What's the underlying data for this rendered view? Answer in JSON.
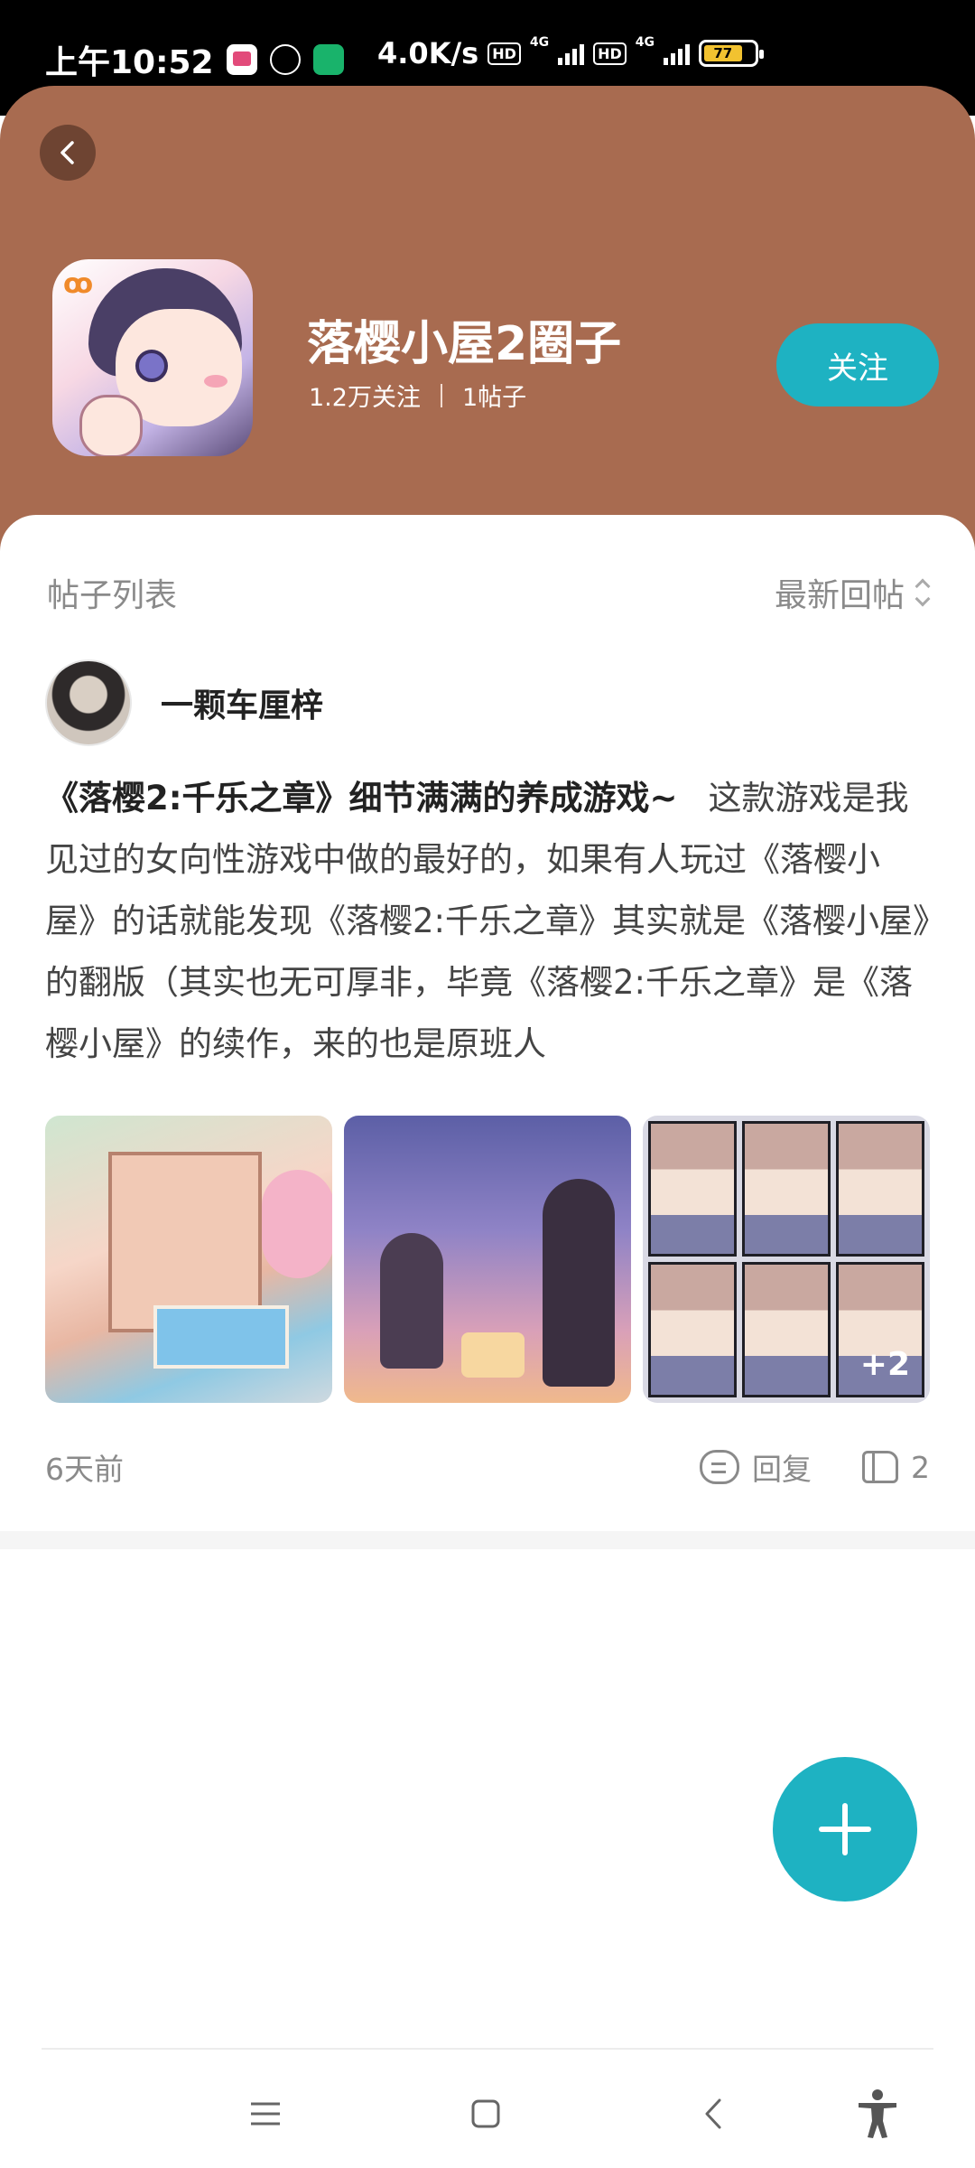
{
  "status_bar": {
    "time": "上午10:52",
    "network_speed": "4.0K/s",
    "hd_label": "HD",
    "signal_label": "4G",
    "battery": "77"
  },
  "circle": {
    "title": "落樱小屋2圈子",
    "followers": "1.2万关注",
    "posts_count": "1帖子",
    "follow_label": "关注",
    "header_color": "#a86b50",
    "accent_color": "#1eb2c2"
  },
  "post_list": {
    "title": "帖子列表",
    "sort_label": "最新回帖"
  },
  "post": {
    "author": "一颗车厘梓",
    "title": "《落樱2:千乐之章》细节满满的养成游戏~",
    "body": "这款游戏是我见过的女向性游戏中做的最好的，如果有人玩过《落樱小屋》的话就能发现《落樱2:千乐之章》其实就是《落樱小屋》的翻版（其实也无可厚非，毕竟《落樱2:千乐之章》是《落樱小屋》的续作，来的也是原班人",
    "more_images": "+2",
    "time": "6天前",
    "reply_label": "回复",
    "like_count": "2"
  },
  "icons": {
    "back": "chevron-left-icon",
    "sort": "sort-updown-icon",
    "reply": "comment-icon",
    "like": "thumbs-up-icon",
    "fab": "plus-icon",
    "nav_menu": "menu-icon",
    "nav_home": "home-square-icon",
    "nav_back": "back-icon",
    "accessibility": "accessibility-icon"
  }
}
